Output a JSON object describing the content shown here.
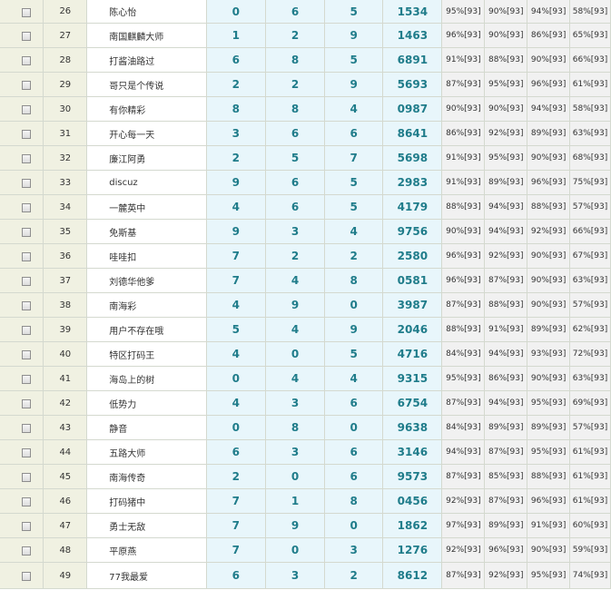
{
  "rows": [
    {
      "no": "26",
      "name": "陈心怡",
      "d1": "0",
      "d2": "6",
      "d3": "5",
      "code": "1534",
      "p1": "95%[93]",
      "p2": "90%[93]",
      "p3": "94%[93]",
      "p4": "58%[93]"
    },
    {
      "no": "27",
      "name": "南国麒麟大师",
      "d1": "1",
      "d2": "2",
      "d3": "9",
      "code": "1463",
      "p1": "96%[93]",
      "p2": "90%[93]",
      "p3": "86%[93]",
      "p4": "65%[93]"
    },
    {
      "no": "28",
      "name": "打酱油路过",
      "d1": "6",
      "d2": "8",
      "d3": "5",
      "code": "6891",
      "p1": "91%[93]",
      "p2": "88%[93]",
      "p3": "90%[93]",
      "p4": "66%[93]"
    },
    {
      "no": "29",
      "name": "哥只是个传说",
      "d1": "2",
      "d2": "2",
      "d3": "9",
      "code": "5693",
      "p1": "87%[93]",
      "p2": "95%[93]",
      "p3": "96%[93]",
      "p4": "61%[93]"
    },
    {
      "no": "30",
      "name": "有你精彩",
      "d1": "8",
      "d2": "8",
      "d3": "4",
      "code": "0987",
      "p1": "90%[93]",
      "p2": "90%[93]",
      "p3": "94%[93]",
      "p4": "58%[93]"
    },
    {
      "no": "31",
      "name": "开心每一天",
      "d1": "3",
      "d2": "6",
      "d3": "6",
      "code": "8641",
      "p1": "86%[93]",
      "p2": "92%[93]",
      "p3": "89%[93]",
      "p4": "63%[93]"
    },
    {
      "no": "32",
      "name": "廉江阿勇",
      "d1": "2",
      "d2": "5",
      "d3": "7",
      "code": "5698",
      "p1": "91%[93]",
      "p2": "95%[93]",
      "p3": "90%[93]",
      "p4": "68%[93]"
    },
    {
      "no": "33",
      "name": "discuz",
      "d1": "9",
      "d2": "6",
      "d3": "5",
      "code": "2983",
      "p1": "91%[93]",
      "p2": "89%[93]",
      "p3": "96%[93]",
      "p4": "75%[93]"
    },
    {
      "no": "34",
      "name": "一麓英中",
      "d1": "4",
      "d2": "6",
      "d3": "5",
      "code": "4179",
      "p1": "88%[93]",
      "p2": "94%[93]",
      "p3": "88%[93]",
      "p4": "57%[93]"
    },
    {
      "no": "35",
      "name": "免斯基",
      "d1": "9",
      "d2": "3",
      "d3": "4",
      "code": "9756",
      "p1": "90%[93]",
      "p2": "94%[93]",
      "p3": "92%[93]",
      "p4": "66%[93]"
    },
    {
      "no": "36",
      "name": "哇哇扣",
      "d1": "7",
      "d2": "2",
      "d3": "2",
      "code": "2580",
      "p1": "96%[93]",
      "p2": "92%[93]",
      "p3": "90%[93]",
      "p4": "67%[93]"
    },
    {
      "no": "37",
      "name": "刘德华他爹",
      "d1": "7",
      "d2": "4",
      "d3": "8",
      "code": "0581",
      "p1": "96%[93]",
      "p2": "87%[93]",
      "p3": "90%[93]",
      "p4": "63%[93]"
    },
    {
      "no": "38",
      "name": "南海彩",
      "d1": "4",
      "d2": "9",
      "d3": "0",
      "code": "3987",
      "p1": "87%[93]",
      "p2": "88%[93]",
      "p3": "90%[93]",
      "p4": "57%[93]"
    },
    {
      "no": "39",
      "name": "用户不存在哦",
      "d1": "5",
      "d2": "4",
      "d3": "9",
      "code": "2046",
      "p1": "88%[93]",
      "p2": "91%[93]",
      "p3": "89%[93]",
      "p4": "62%[93]"
    },
    {
      "no": "40",
      "name": "特区打码王",
      "d1": "4",
      "d2": "0",
      "d3": "5",
      "code": "4716",
      "p1": "84%[93]",
      "p2": "94%[93]",
      "p3": "93%[93]",
      "p4": "72%[93]"
    },
    {
      "no": "41",
      "name": "海岛上的树",
      "d1": "0",
      "d2": "4",
      "d3": "4",
      "code": "9315",
      "p1": "95%[93]",
      "p2": "86%[93]",
      "p3": "90%[93]",
      "p4": "63%[93]"
    },
    {
      "no": "42",
      "name": "低势力",
      "d1": "4",
      "d2": "3",
      "d3": "6",
      "code": "6754",
      "p1": "87%[93]",
      "p2": "94%[93]",
      "p3": "95%[93]",
      "p4": "69%[93]"
    },
    {
      "no": "43",
      "name": "静音",
      "d1": "0",
      "d2": "8",
      "d3": "0",
      "code": "9638",
      "p1": "84%[93]",
      "p2": "89%[93]",
      "p3": "89%[93]",
      "p4": "57%[93]"
    },
    {
      "no": "44",
      "name": "五路大师",
      "d1": "6",
      "d2": "3",
      "d3": "6",
      "code": "3146",
      "p1": "94%[93]",
      "p2": "87%[93]",
      "p3": "95%[93]",
      "p4": "61%[93]"
    },
    {
      "no": "45",
      "name": "南海传奇",
      "d1": "2",
      "d2": "0",
      "d3": "6",
      "code": "9573",
      "p1": "87%[93]",
      "p2": "85%[93]",
      "p3": "88%[93]",
      "p4": "61%[93]"
    },
    {
      "no": "46",
      "name": "打码猪中",
      "d1": "7",
      "d2": "1",
      "d3": "8",
      "code": "0456",
      "p1": "92%[93]",
      "p2": "87%[93]",
      "p3": "96%[93]",
      "p4": "61%[93]"
    },
    {
      "no": "47",
      "name": "勇士无敌",
      "d1": "7",
      "d2": "9",
      "d3": "0",
      "code": "1862",
      "p1": "97%[93]",
      "p2": "89%[93]",
      "p3": "91%[93]",
      "p4": "60%[93]"
    },
    {
      "no": "48",
      "name": "平原燕",
      "d1": "7",
      "d2": "0",
      "d3": "3",
      "code": "1276",
      "p1": "92%[93]",
      "p2": "96%[93]",
      "p3": "90%[93]",
      "p4": "59%[93]"
    },
    {
      "no": "49",
      "name": "77我最爱",
      "d1": "6",
      "d2": "3",
      "d3": "2",
      "code": "8612",
      "p1": "87%[93]",
      "p2": "92%[93]",
      "p3": "95%[93]",
      "p4": "74%[93]"
    }
  ]
}
